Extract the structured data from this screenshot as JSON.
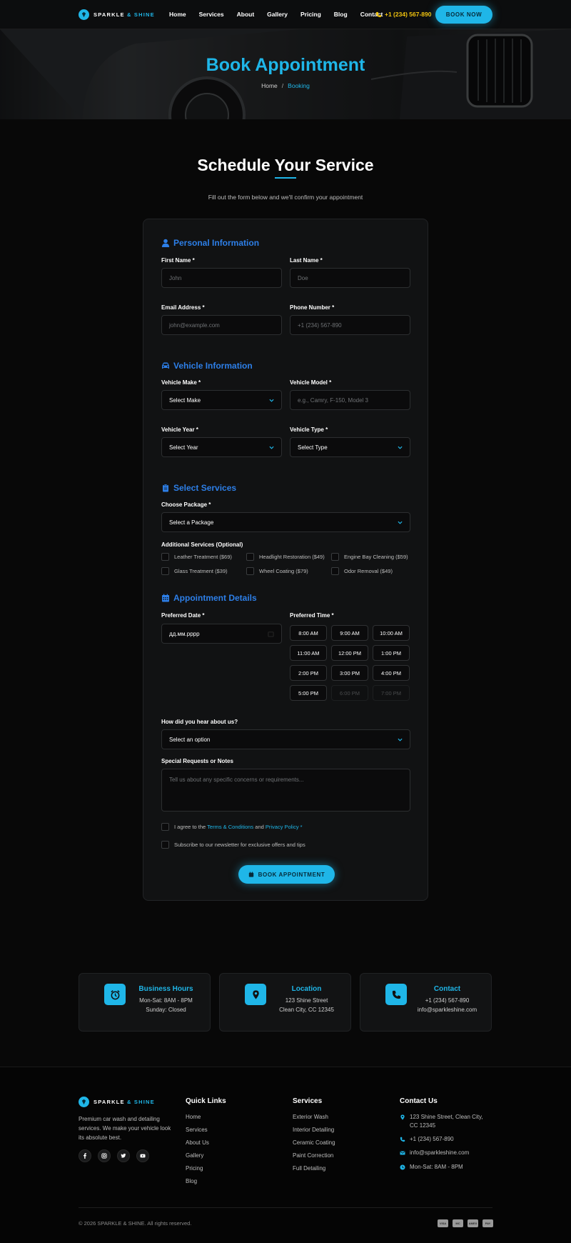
{
  "brand": {
    "name_part1": "SPARKLE",
    "amp": "&",
    "name_part2": "SHINE"
  },
  "nav": {
    "links": [
      "Home",
      "Services",
      "About",
      "Gallery",
      "Pricing",
      "Blog",
      "Contact"
    ],
    "phone": "+1 (234) 567-890",
    "book_label": "BOOK NOW"
  },
  "hero": {
    "title": "Book Appointment",
    "breadcrumb_home": "Home",
    "breadcrumb_sep": "/",
    "breadcrumb_current": "Booking"
  },
  "section": {
    "title": "Schedule Your Service",
    "subtitle": "Fill out the form below and we'll confirm your appointment"
  },
  "form": {
    "personal": {
      "title": "Personal Information",
      "first_name_label": "First Name *",
      "first_name_placeholder": "John",
      "last_name_label": "Last Name *",
      "last_name_placeholder": "Doe",
      "email_label": "Email Address *",
      "email_placeholder": "john@example.com",
      "phone_label": "Phone Number *",
      "phone_placeholder": "+1 (234) 567-890"
    },
    "vehicle": {
      "title": "Vehicle Information",
      "make_label": "Vehicle Make *",
      "make_value": "Select Make",
      "model_label": "Vehicle Model *",
      "model_placeholder": "e.g., Camry, F-150, Model 3",
      "year_label": "Vehicle Year *",
      "year_value": "Select Year",
      "type_label": "Vehicle Type *",
      "type_value": "Select Type"
    },
    "services": {
      "title": "Select Services",
      "package_label": "Choose Package *",
      "package_value": "Select a Package",
      "additional_label": "Additional Services (Optional)",
      "additional": [
        "Leather Treatment ($69)",
        "Headlight Restoration ($49)",
        "Engine Bay Cleaning ($59)",
        "Glass Treatment ($39)",
        "Wheel Coating ($79)",
        "Odor Removal ($49)"
      ]
    },
    "appointment": {
      "title": "Appointment Details",
      "date_label": "Preferred Date *",
      "date_value": "дд.мм.рррр",
      "time_label": "Preferred Time *",
      "times": [
        "8:00 AM",
        "9:00 AM",
        "10:00 AM",
        "11:00 AM",
        "12:00 PM",
        "1:00 PM",
        "2:00 PM",
        "3:00 PM",
        "4:00 PM",
        "5:00 PM",
        "6:00 PM",
        "7:00 PM"
      ],
      "hear_label": "How did you hear about us?",
      "hear_value": "Select an option",
      "notes_label": "Special Requests or Notes",
      "notes_placeholder": "Tell us about any specific concerns or requirements..."
    },
    "agree_prefix": "I agree to the",
    "agree_terms": "Terms & Conditions",
    "agree_and": "and",
    "agree_privacy": "Privacy Policy",
    "agree_star": "*",
    "newsletter": "Subscribe to our newsletter for exclusive offers and tips",
    "submit_label": "BOOK APPOINTMENT"
  },
  "info_cards": [
    {
      "title": "Business Hours",
      "line1": "Mon-Sat: 8AM - 8PM",
      "line2": "Sunday: Closed",
      "icon": "alarm-clock-icon"
    },
    {
      "title": "Location",
      "line1": "123 Shine Street",
      "line2": "Clean City, CC 12345",
      "icon": "map-pin-icon"
    },
    {
      "title": "Contact",
      "line1": "+1 (234) 567-890",
      "line2": "info@sparkleshine.com",
      "icon": "phone-icon"
    }
  ],
  "footer": {
    "description": "Premium car wash and detailing services. We make your vehicle look its absolute best.",
    "quick_links_title": "Quick Links",
    "quick_links": [
      "Home",
      "Services",
      "About Us",
      "Gallery",
      "Pricing",
      "Blog"
    ],
    "services_title": "Services",
    "services": [
      "Exterior Wash",
      "Interior Detailing",
      "Ceramic Coating",
      "Paint Correction",
      "Full Detailing"
    ],
    "contact_title": "Contact Us",
    "contact_address": "123 Shine Street, Clean City, CC 12345",
    "contact_phone": "+1 (234) 567-890",
    "contact_email": "info@sparkleshine.com",
    "contact_hours": "Mon-Sat: 8AM - 8PM",
    "copyright": "© 2026 SPARKLE & SHINE. All rights reserved.",
    "payments": [
      "VISA",
      "MC",
      "AMEX",
      "PAY"
    ]
  },
  "colors": {
    "accent": "#1fb6e8",
    "heading_blue": "#2d7fe8",
    "phone_yellow": "#f2c40f",
    "bg": "#080808"
  }
}
